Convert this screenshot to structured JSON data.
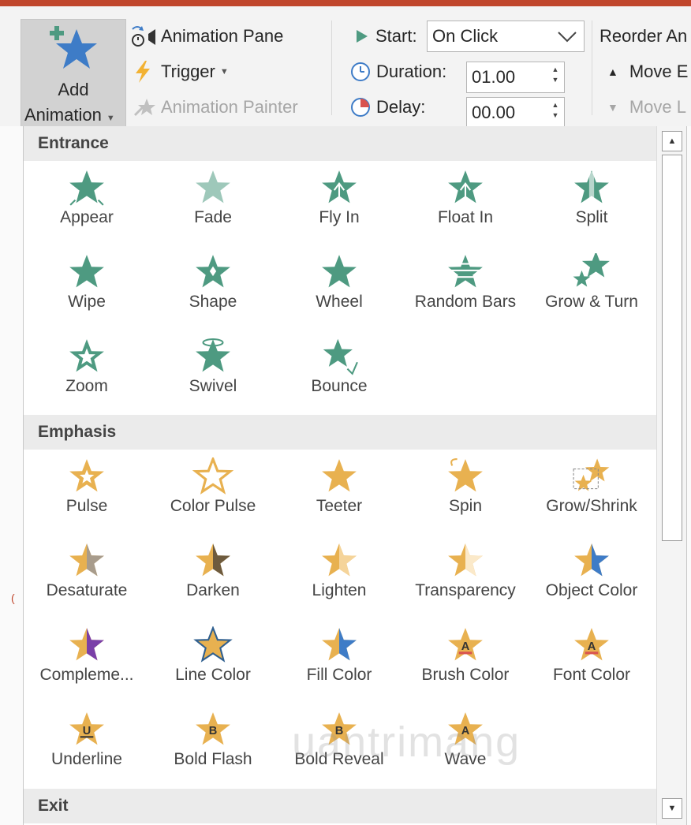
{
  "ribbon": {
    "add_animation": {
      "line1": "Add",
      "line2": "Animation"
    },
    "animation_pane": "Animation Pane",
    "trigger": "Trigger",
    "animation_painter": "Animation Painter",
    "start_label": "Start:",
    "start_value": "On Click",
    "duration_label": "Duration:",
    "duration_value": "01.00",
    "delay_label": "Delay:",
    "delay_value": "00.00",
    "reorder_label": "Reorder An",
    "move_earlier": "Move E",
    "move_later": "Move L"
  },
  "gallery": {
    "sections": [
      {
        "title": "Entrance",
        "color": "#4e9a81",
        "items": [
          {
            "label": "Appear",
            "icon": "star-appear-icon"
          },
          {
            "label": "Fade",
            "icon": "star-fade-icon"
          },
          {
            "label": "Fly In",
            "icon": "star-fly-in-icon"
          },
          {
            "label": "Float In",
            "icon": "star-float-in-icon"
          },
          {
            "label": "Split",
            "icon": "star-split-icon"
          },
          {
            "label": "Wipe",
            "icon": "star-wipe-icon"
          },
          {
            "label": "Shape",
            "icon": "star-shape-icon"
          },
          {
            "label": "Wheel",
            "icon": "star-wheel-icon"
          },
          {
            "label": "Random Bars",
            "icon": "star-random-bars-icon"
          },
          {
            "label": "Grow & Turn",
            "icon": "star-grow-turn-icon"
          },
          {
            "label": "Zoom",
            "icon": "star-zoom-icon"
          },
          {
            "label": "Swivel",
            "icon": "star-swivel-icon"
          },
          {
            "label": "Bounce",
            "icon": "star-bounce-icon"
          }
        ]
      },
      {
        "title": "Emphasis",
        "color": "#e8b150",
        "items": [
          {
            "label": "Pulse",
            "icon": "star-pulse-icon"
          },
          {
            "label": "Color Pulse",
            "icon": "star-color-pulse-icon"
          },
          {
            "label": "Teeter",
            "icon": "star-teeter-icon"
          },
          {
            "label": "Spin",
            "icon": "star-spin-icon"
          },
          {
            "label": "Grow/Shrink",
            "icon": "star-grow-shrink-icon"
          },
          {
            "label": "Desaturate",
            "icon": "star-desaturate-icon"
          },
          {
            "label": "Darken",
            "icon": "star-darken-icon"
          },
          {
            "label": "Lighten",
            "icon": "star-lighten-icon"
          },
          {
            "label": "Transparency",
            "icon": "star-transparency-icon"
          },
          {
            "label": "Object Color",
            "icon": "star-object-color-icon"
          },
          {
            "label": "Compleme...",
            "icon": "star-complementary-icon"
          },
          {
            "label": "Line Color",
            "icon": "star-line-color-icon"
          },
          {
            "label": "Fill Color",
            "icon": "star-fill-color-icon"
          },
          {
            "label": "Brush Color",
            "icon": "star-brush-color-icon"
          },
          {
            "label": "Font Color",
            "icon": "star-font-color-icon"
          },
          {
            "label": "Underline",
            "icon": "star-underline-icon"
          },
          {
            "label": "Bold Flash",
            "icon": "star-bold-flash-icon"
          },
          {
            "label": "Bold Reveal",
            "icon": "star-bold-reveal-icon"
          },
          {
            "label": "Wave",
            "icon": "star-wave-icon"
          }
        ]
      },
      {
        "title": "Exit",
        "color": "#d9534f",
        "items": []
      }
    ]
  },
  "watermark": "uantrimang",
  "colors": {
    "entrance": "#4e9a81",
    "emphasis": "#e8b150",
    "accent_blue": "#3e7cc7",
    "ribbon_bg": "#f3f3f3",
    "title_bar": "#c0462c"
  }
}
